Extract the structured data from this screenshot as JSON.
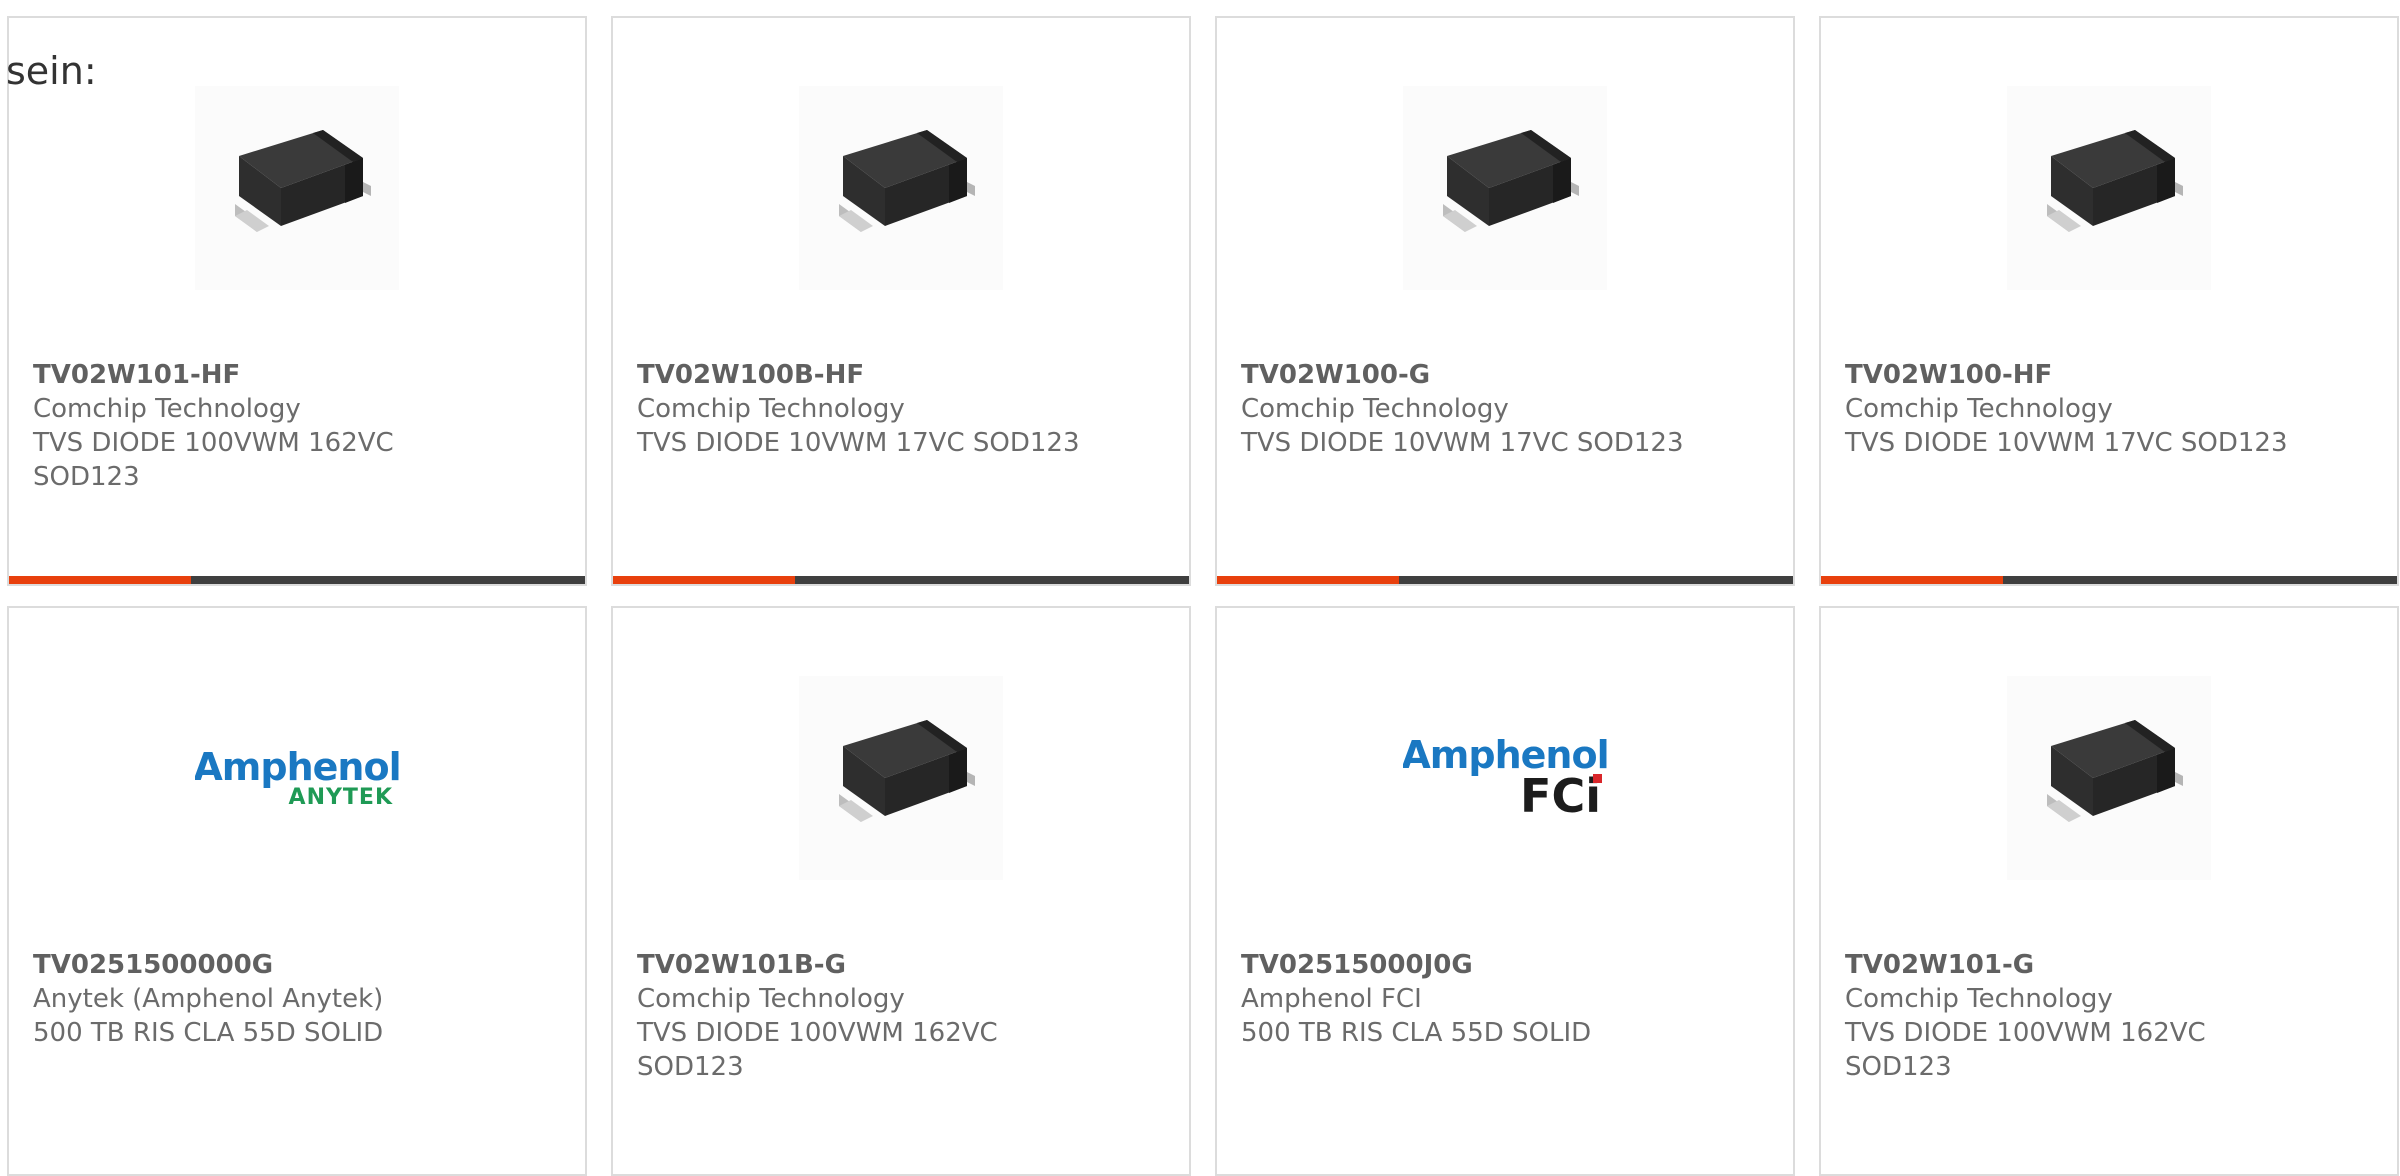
{
  "intro_text": "sein:",
  "colors": {
    "accent": "#e8400d",
    "bar_track": "#3f3f3f",
    "amphenol_blue": "#1a78c2",
    "anytek_green": "#1f9a55",
    "fci_black": "#1c1c1c",
    "fci_red": "#d9262a"
  },
  "products": [
    {
      "part_number": "TV02W101-HF",
      "manufacturer": "Comchip Technology",
      "description": "TVS DIODE 100VWM 162VC SOD123",
      "image": "diode-package-icon"
    },
    {
      "part_number": "TV02W100B-HF",
      "manufacturer": "Comchip Technology",
      "description": "TVS DIODE 10VWM 17VC SOD123",
      "image": "diode-package-icon"
    },
    {
      "part_number": "TV02W100-G",
      "manufacturer": "Comchip Technology",
      "description": "TVS DIODE 10VWM 17VC SOD123",
      "image": "diode-package-icon"
    },
    {
      "part_number": "TV02W100-HF",
      "manufacturer": "Comchip Technology",
      "description": "TVS DIODE 10VWM 17VC SOD123",
      "image": "diode-package-icon"
    },
    {
      "part_number": "TV0251500000G",
      "manufacturer": "Anytek (Amphenol Anytek)",
      "description": "500 TB RIS CLA 55D SOLID",
      "image": "amphenol-anytek-logo",
      "logo_line1": "Amphenol",
      "logo_line2": "ANYTEK"
    },
    {
      "part_number": "TV02W101B-G",
      "manufacturer": "Comchip Technology",
      "description": "TVS DIODE 100VWM 162VC SOD123",
      "image": "diode-package-icon"
    },
    {
      "part_number": "TV02515000J0G",
      "manufacturer": "Amphenol FCI",
      "description": "500 TB RIS CLA 55D SOLID",
      "image": "amphenol-fci-logo",
      "logo_line1": "Amphenol",
      "logo_line2": "FCi"
    },
    {
      "part_number": "TV02W101-G",
      "manufacturer": "Comchip Technology",
      "description": "TVS DIODE 100VWM 162VC SOD123",
      "image": "diode-package-icon"
    }
  ]
}
